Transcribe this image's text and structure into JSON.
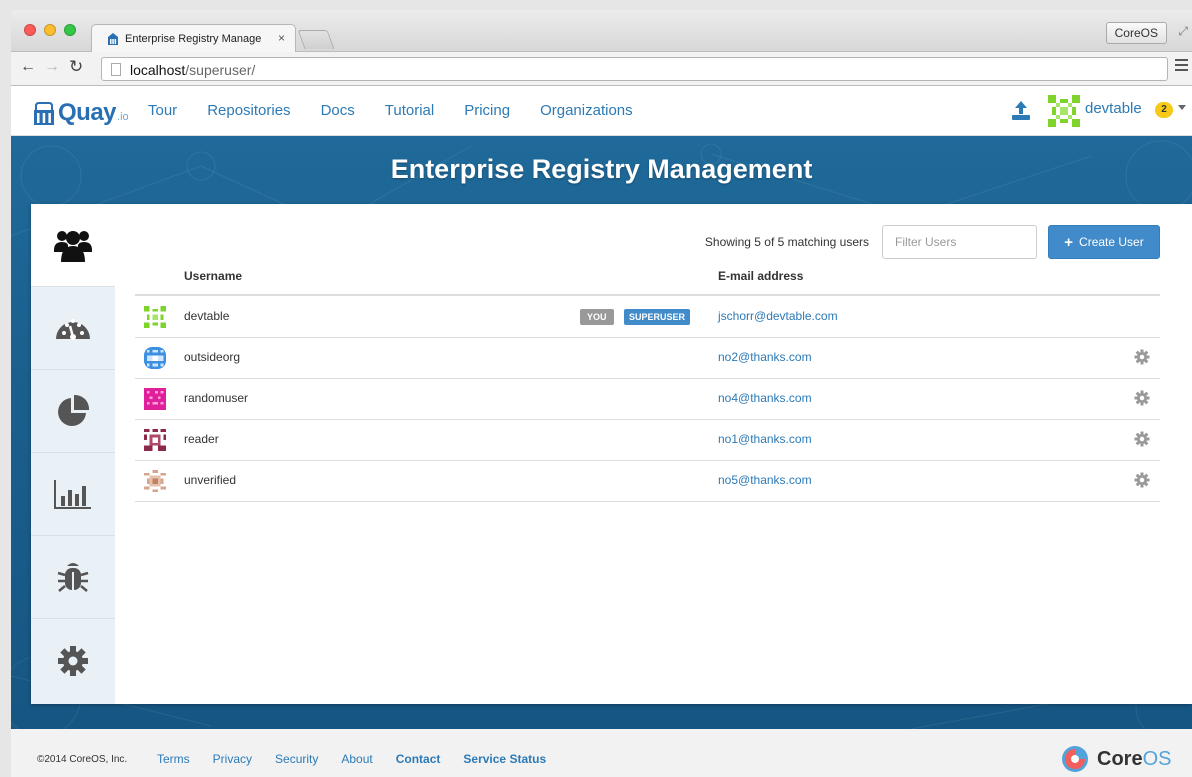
{
  "browser": {
    "tab_title": "Enterprise Registry Manage",
    "tab_close": "×",
    "profile_button": "CoreOS",
    "url_host": "localhost",
    "url_path": "/superuser/"
  },
  "header": {
    "logo_text": "Quay",
    "logo_suffix": ".io",
    "nav": [
      "Tour",
      "Repositories",
      "Docs",
      "Tutorial",
      "Pricing",
      "Organizations"
    ],
    "username": "devtable",
    "notification_count": "2"
  },
  "page": {
    "title": "Enterprise Registry Management"
  },
  "users_panel": {
    "showing_text": "Showing 5 of 5 matching users",
    "filter_placeholder": "Filter Users",
    "create_button_label": "Create User",
    "columns": {
      "username": "Username",
      "email": "E-mail address"
    },
    "badges": {
      "you": "YOU",
      "superuser": "SUPERUSER"
    },
    "users": [
      {
        "username": "devtable",
        "email": "jschorr@devtable.com"
      },
      {
        "username": "outsideorg",
        "email": "no2@thanks.com"
      },
      {
        "username": "randomuser",
        "email": "no4@thanks.com"
      },
      {
        "username": "reader",
        "email": "no1@thanks.com"
      },
      {
        "username": "unverified",
        "email": "no5@thanks.com"
      }
    ]
  },
  "side_tabs": [
    "users-icon",
    "dashboard-icon",
    "pie-chart-icon",
    "bar-chart-icon",
    "bug-icon",
    "gear-icon"
  ],
  "footer": {
    "copyright": "©2014 CoreOS, Inc.",
    "links": [
      "Terms",
      "Privacy",
      "Security",
      "About",
      "Contact",
      "Service Status"
    ],
    "brand_bold": "Core",
    "brand_light": "OS"
  },
  "colors": {
    "brand_blue": "#2c7ab6",
    "banner_blue": "#1f6a9a",
    "primary_button": "#428bca",
    "badge_yellow": "#f7ca18"
  }
}
